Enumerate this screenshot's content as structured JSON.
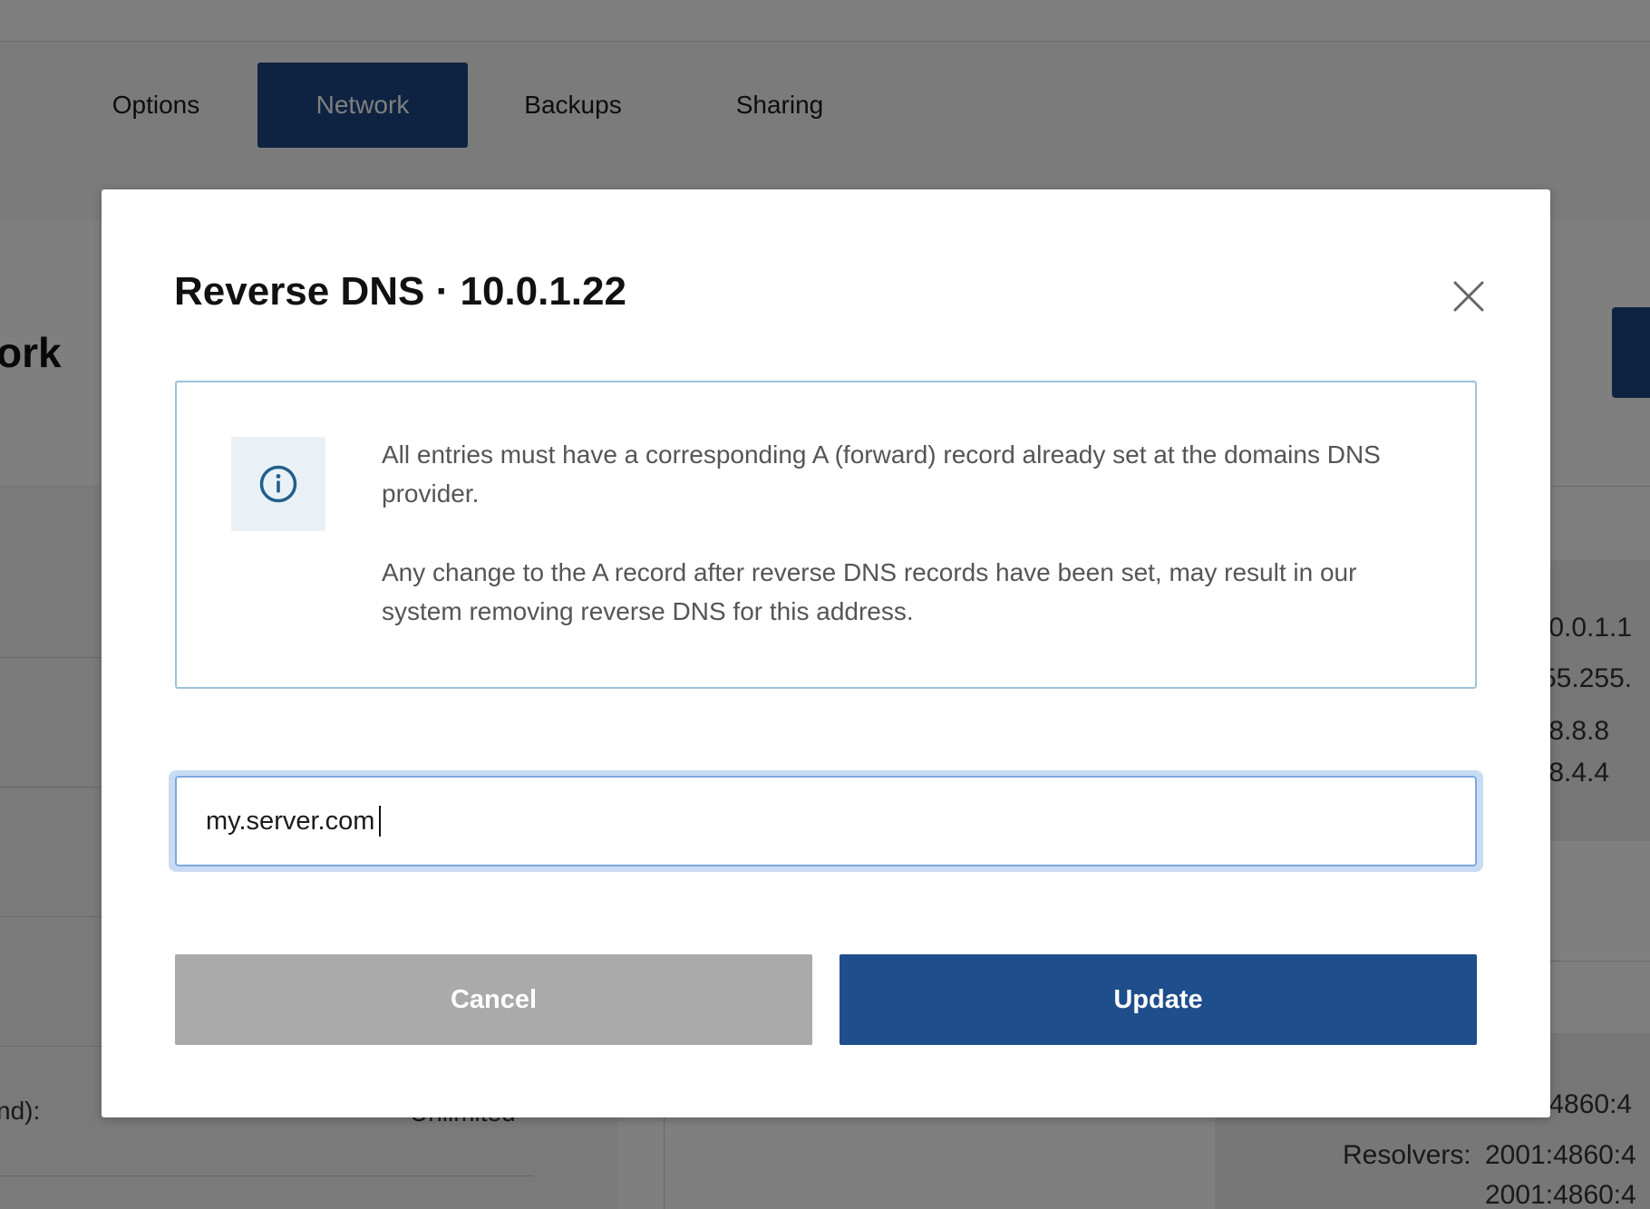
{
  "tabs": [
    {
      "label": "Options",
      "active": false
    },
    {
      "label": "Network",
      "active": true
    },
    {
      "label": "Backups",
      "active": false
    },
    {
      "label": "Sharing",
      "active": false
    }
  ],
  "background": {
    "section_title_fragment": "ork",
    "left_label_fragment": "nd):",
    "left_value_fragment": "Unlimited",
    "right_values": [
      ".0.0.1.1",
      "55.255.",
      ".8.8.8",
      ".8.4.4",
      ":4860:4"
    ],
    "resolvers_label": "Resolvers:",
    "resolvers_values": [
      "2001:4860:4",
      "2001:4860:4"
    ]
  },
  "modal": {
    "title": "Reverse DNS · 10.0.1.22",
    "close_icon": "close-icon",
    "info_icon": "info-icon",
    "info_paragraphs": [
      "All entries must have a corresponding A (forward) record already set at the domains DNS provider.",
      "Any change to the A record after reverse DNS records have been set, may result in our system removing reverse DNS for this address."
    ],
    "hostname_value": "my.server.com",
    "cancel_label": "Cancel",
    "update_label": "Update"
  },
  "colors": {
    "primary": "#1f4e8c",
    "tab_active": "#1a4782",
    "cancel": "#aaaaaa",
    "info_border": "#9ec3d8",
    "focus_ring": "#c9dcf5"
  }
}
